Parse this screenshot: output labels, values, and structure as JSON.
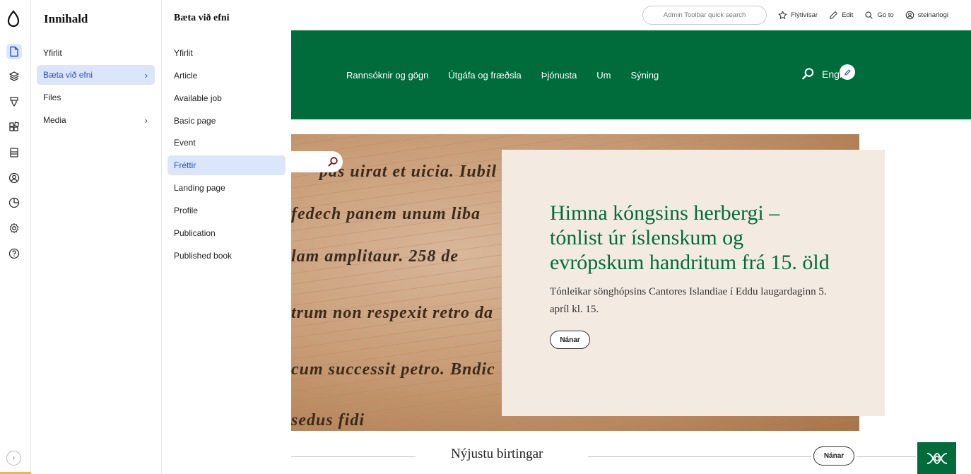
{
  "toolbar": {
    "search_placeholder": "Admin Toolbar quick search",
    "shortcuts_label": "Flýtivísar",
    "edit_label": "Edit",
    "goto_label": "Go to",
    "user_label": "steinarlogi"
  },
  "header": {
    "nav": [
      "Rannsóknir og gögn",
      "Útgáfa og fræðsla",
      "Þjónusta",
      "Um",
      "Sýning"
    ],
    "language_label": "Engl"
  },
  "hero": {
    "image_text": [
      "pas uirat et uicia. Iubil",
      "fedech panem unum liba",
      "lam amplitaur. 258 de",
      "trum non respexit retro da",
      "cum successit petro. Bndic",
      "sedus fidi"
    ],
    "title": "Himna kóngsins herbergi – tónlist úr íslenskum og evrópskum handritum frá 15. öld",
    "subtitle": "Tónleikar sönghópsins Cantores Islandiae í Eddu laugardaginn 5. apríl kl. 15.",
    "button_label": "Nánar"
  },
  "latest": {
    "title": "Nýjustu birtingar",
    "button_label": "Nánar"
  },
  "sidebar": {
    "panel1_title": "Innihald",
    "panel1_items": [
      {
        "label": "Yfirlit",
        "has_children": false
      },
      {
        "label": "Bæta við efni",
        "has_children": true,
        "active": true
      },
      {
        "label": "Files",
        "has_children": false
      },
      {
        "label": "Media",
        "has_children": true
      }
    ],
    "panel2_title": "Bæta við efni",
    "panel2_items": [
      {
        "label": "Yfirlit"
      },
      {
        "label": "Article"
      },
      {
        "label": "Available job"
      },
      {
        "label": "Basic page"
      },
      {
        "label": "Event"
      },
      {
        "label": "Fréttir",
        "active": true
      },
      {
        "label": "Landing page"
      },
      {
        "label": "Profile"
      },
      {
        "label": "Publication"
      },
      {
        "label": "Published book"
      }
    ],
    "rail_icons": [
      "content-icon",
      "structure-icon",
      "appearance-icon",
      "extend-icon",
      "config-icon",
      "people-icon",
      "reports-icon",
      "settings-icon",
      "help-icon"
    ],
    "expand_symbol": "›"
  },
  "colors": {
    "brand_green": "#006c3b",
    "card_bg": "#f3ebe1",
    "active_bg": "#dce6fb",
    "active_text": "#2552c8"
  }
}
